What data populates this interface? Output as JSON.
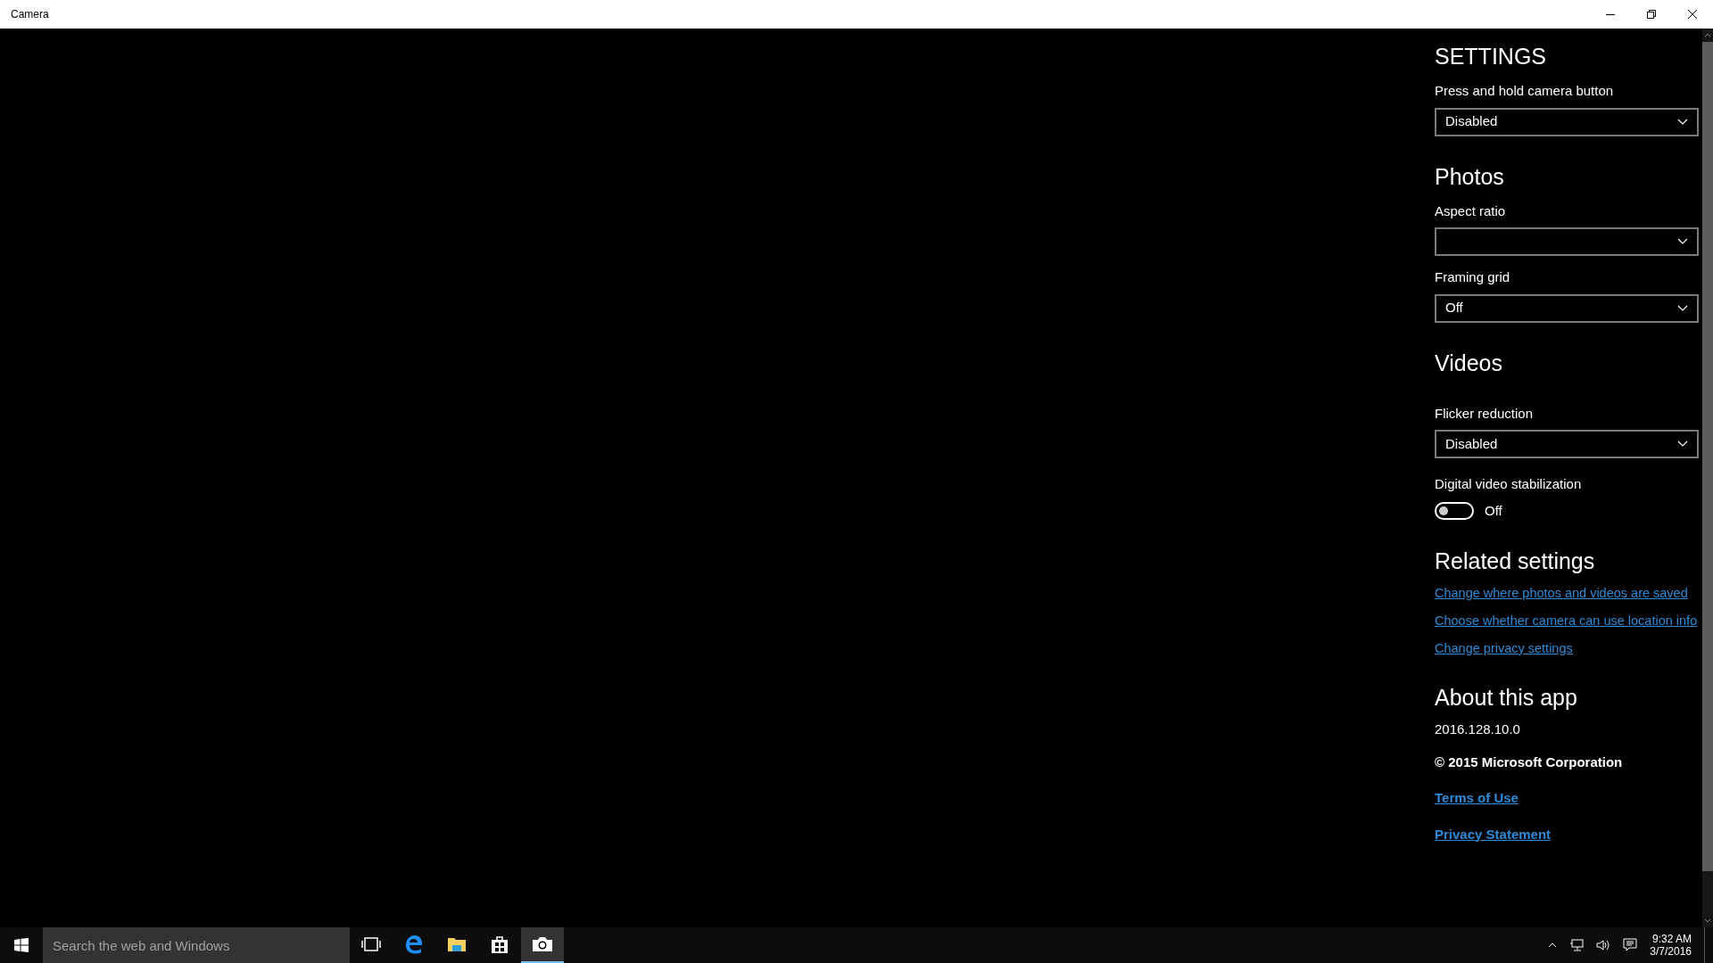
{
  "window": {
    "title": "Camera"
  },
  "settings": {
    "title": "SETTINGS",
    "items": [
      {
        "kind": "dropdown",
        "label": "Press and hold camera button",
        "value": "Disabled"
      }
    ]
  },
  "sections": [
    {
      "heading": "Photos",
      "items": [
        {
          "kind": "dropdown",
          "label": "Aspect ratio"
        },
        {
          "kind": "dropdown",
          "label": "Framing grid",
          "value": "Off"
        }
      ]
    },
    {
      "heading": "Videos",
      "items": [
        {
          "kind": "dropdown",
          "label": "Flicker reduction",
          "value": "Disabled"
        },
        {
          "kind": "toggle",
          "label": "Digital video stabilization",
          "on": false,
          "state_label": "Off"
        }
      ]
    },
    {
      "heading": "Related settings",
      "items": [
        {
          "kind": "link",
          "text": "Change where photos and videos are saved"
        },
        {
          "kind": "link",
          "text": "Choose whether camera can use location info"
        },
        {
          "kind": "link",
          "text": "Change privacy settings"
        }
      ]
    },
    {
      "heading": "About this app",
      "items": [
        {
          "kind": "text",
          "text": "2016.128.10.0"
        },
        {
          "kind": "bold_text",
          "text": "© 2015 Microsoft Corporation"
        },
        {
          "kind": "bold_link",
          "text": "Terms of Use"
        },
        {
          "kind": "bold_link",
          "text": "Privacy Statement"
        }
      ]
    }
  ],
  "taskbar": {
    "search": {
      "placeholder": "Search the web and Windows"
    },
    "apps": [
      {
        "kind": "task-view",
        "selected": false
      },
      {
        "kind": "edge",
        "selected": false
      },
      {
        "kind": "explorer",
        "selected": false
      },
      {
        "kind": "store",
        "selected": false
      },
      {
        "kind": "camera",
        "selected": true
      }
    ],
    "clock": {
      "time": "9:32 AM",
      "date": "3/7/2016"
    }
  }
}
